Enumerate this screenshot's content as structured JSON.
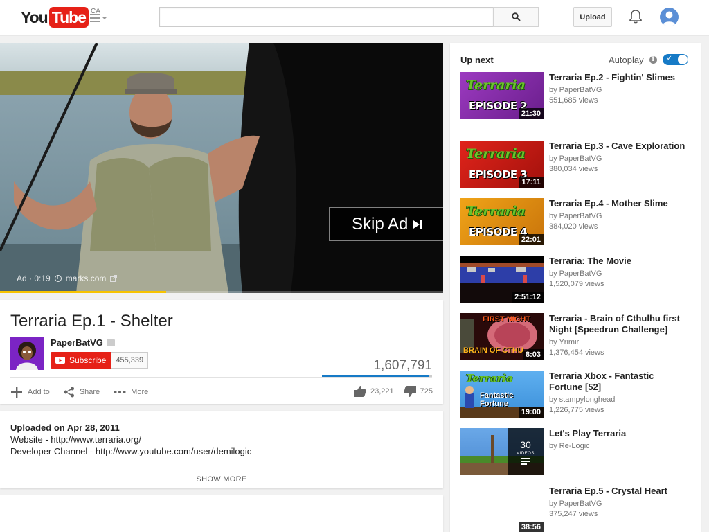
{
  "header": {
    "logo_you": "You",
    "logo_tube": "Tube",
    "region": "CA",
    "search_placeholder": "",
    "upload_label": "Upload"
  },
  "player": {
    "skip_ad_label": "Skip Ad",
    "ad_label": "Ad · 0:19",
    "ad_domain": "marks.com",
    "progress_fraction": 0.375
  },
  "video": {
    "title": "Terraria Ep.1 - Shelter",
    "channel": "PaperBatVG",
    "subscribe_label": "Subscribe",
    "subscriber_count": "455,339",
    "views": "1,607,791",
    "like_fraction": 0.97,
    "actions": {
      "add_to": "Add to",
      "share": "Share",
      "more": "More"
    },
    "likes": "23,221",
    "dislikes": "725"
  },
  "description": {
    "uploaded": "Uploaded on Apr 28, 2011",
    "website": "Website - http://www.terraria.org/",
    "developer": "Developer Channel - http://www.youtube.com/user/demilogic",
    "show_more": "SHOW MORE"
  },
  "sidebar": {
    "up_next_label": "Up next",
    "autoplay_label": "Autoplay",
    "autoplay_on": true,
    "recommendations": [
      {
        "title": "Terraria Ep.2 - Fightin' Slimes",
        "channel": "by PaperBatVG",
        "views": "551,685 views",
        "duration": "21:30",
        "thumb_text": "EPISODE 2"
      },
      {
        "title": "Terraria Ep.3 - Cave Exploration",
        "channel": "by PaperBatVG",
        "views": "380,034 views",
        "duration": "17:11",
        "thumb_text": "EPISODE 3"
      },
      {
        "title": "Terraria Ep.4 - Mother Slime",
        "channel": "by PaperBatVG",
        "views": "384,020 views",
        "duration": "22:01",
        "thumb_text": "EPISODE 4"
      },
      {
        "title": "Terraria: The Movie",
        "channel": "by PaperBatVG",
        "views": "1,520,079 views",
        "duration": "2:51:12"
      },
      {
        "title": "Terraria - Brain of Cthulhu first Night [Speedrun Challenge]",
        "channel": "by Yrimir",
        "views": "1,376,454 views",
        "duration": "8:03",
        "thumb_top": "FIRST NIGHT",
        "thumb_bottom": "BRAIN OF CTHU"
      },
      {
        "title": "Terraria Xbox - Fantastic Fortune [52]",
        "channel": "by stampylonghead",
        "views": "1,226,775 views",
        "duration": "19:00",
        "thumb_text": "Fantastic Fortune"
      },
      {
        "title": "Let's Play Terraria",
        "channel": "by Re-Logic",
        "playlist_count": "30",
        "playlist_label": "VIDEOS"
      },
      {
        "title": "Terraria Ep.5 - Crystal Heart",
        "channel": "by PaperBatVG",
        "views": "375,247 views",
        "duration": "38:56"
      }
    ]
  },
  "colors": {
    "brand_red": "#e62117",
    "accent_blue": "#167ac6",
    "ad_progress": "#f7c300"
  },
  "icons": [
    "menu-icon",
    "search-icon",
    "bell-icon",
    "avatar-icon",
    "external-link-icon",
    "info-icon",
    "add-icon",
    "share-icon",
    "more-icon",
    "thumb-up-icon",
    "thumb-down-icon",
    "verified-icon",
    "youtube-play-icon",
    "skip-icon",
    "playlist-icon"
  ]
}
